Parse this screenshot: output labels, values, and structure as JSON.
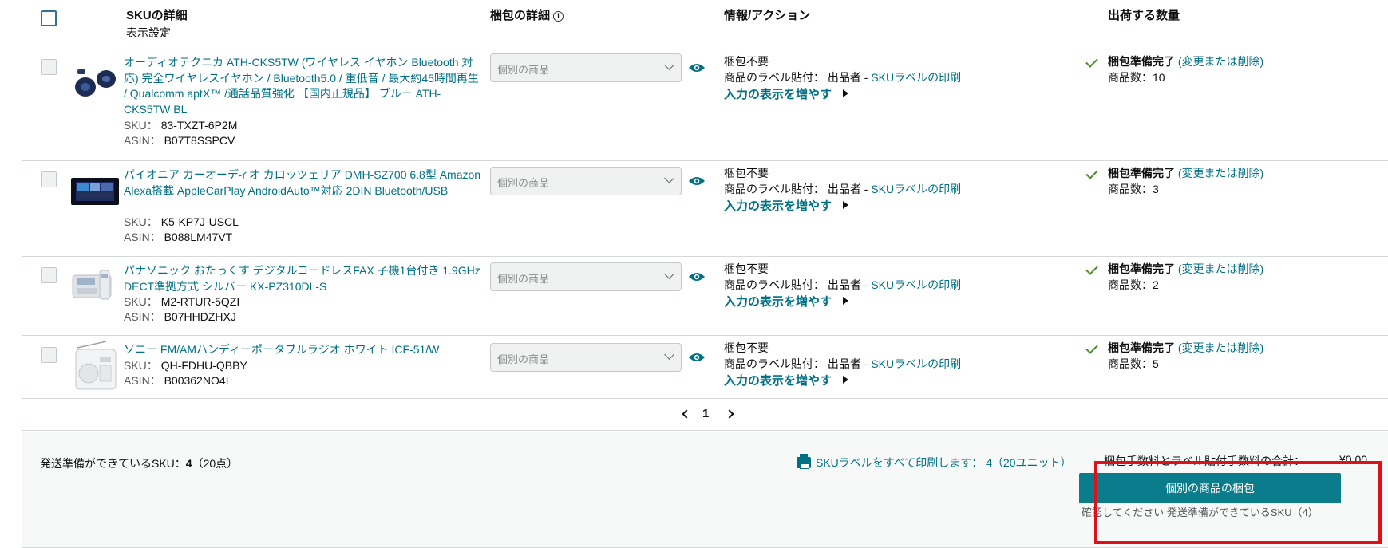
{
  "header": {
    "sku_details": "SKUの詳細",
    "display_settings": "表示設定",
    "packing_details": "梱包の詳細",
    "info_action": "情報/アクション",
    "ship_qty": "出荷する数量"
  },
  "rows": [
    {
      "title": "オーディオテクニカ ATH-CKS5TW (ワイヤレス イヤホン Bluetooth 対応) 完全ワイヤレスイヤホン / Bluetooth5.0 / 重低音 / 最大約45時間再生 / Qualcomm aptX™ /通話品質強化 【国内正規品】 ブルー ATH-CKS5TW BL",
      "sku_label": "SKU：",
      "sku": "83-TXZT-6P2M",
      "asin_label": "ASIN：",
      "asin": "B07T8SSPCV",
      "select": "個別の商品",
      "packing": "梱包不要",
      "label_prefix": "商品のラベル貼付： 出品者 - ",
      "label_link": "SKUラベルの印刷",
      "more": "入力の表示を増やす",
      "status": "梱包準備完了",
      "change": "(変更または削除)",
      "count": "商品数：10"
    },
    {
      "title": "パイオニア カーオーディオ カロッツェリア DMH-SZ700 6.8型 Amazon Alexa搭載 AppleCarPlay AndroidAuto™対応 2DIN Bluetooth/USB",
      "sku_label": "SKU：",
      "sku": "K5-KP7J-USCL",
      "asin_label": "ASIN：",
      "asin": "B088LM47VT",
      "select": "個別の商品",
      "packing": "梱包不要",
      "label_prefix": "商品のラベル貼付： 出品者 - ",
      "label_link": "SKUラベルの印刷",
      "more": "入力の表示を増やす",
      "status": "梱包準備完了",
      "change": "(変更または削除)",
      "count": "商品数：3"
    },
    {
      "title": "パナソニック おたっくす デジタルコードレスFAX 子機1台付き 1.9GHz DECT準拠方式 シルバー KX-PZ310DL-S",
      "sku_label": "SKU：",
      "sku": "M2-RTUR-5QZI",
      "asin_label": "ASIN：",
      "asin": "B07HHDZHXJ",
      "select": "個別の商品",
      "packing": "梱包不要",
      "label_prefix": "商品のラベル貼付： 出品者 - ",
      "label_link": "SKUラベルの印刷",
      "more": "入力の表示を増やす",
      "status": "梱包準備完了",
      "change": "(変更または削除)",
      "count": "商品数：2"
    },
    {
      "title": "ソニー FM/AMハンディーポータブルラジオ ホワイト ICF-51/W",
      "sku_label": "SKU：",
      "sku": "QH-FDHU-QBBY",
      "asin_label": "ASIN：",
      "asin": "B00362NO4I",
      "select": "個別の商品",
      "packing": "梱包不要",
      "label_prefix": "商品のラベル貼付： 出品者 - ",
      "label_link": "SKUラベルの印刷",
      "more": "入力の表示を増やす",
      "status": "梱包準備完了",
      "change": "(変更または削除)",
      "count": "商品数：5"
    }
  ],
  "pager": {
    "page": "1"
  },
  "footer": {
    "ready_label": "発送準備ができているSKU：",
    "ready_count": "4",
    "ready_units": "（20点）",
    "print_all": "SKUラベルをすべて印刷します： 4（20ユニット）",
    "fee_label": "梱包手数料とラベル貼付手数料の合計：",
    "fee_value": "¥0.00",
    "pack_button": "個別の商品の梱包",
    "confirm": "確認してください 発送準備ができているSKU（4）"
  },
  "colors": {
    "link": "#007185",
    "button": "#0a7c8c",
    "highlight": "#e0101a",
    "check": "#4a8a2c"
  }
}
